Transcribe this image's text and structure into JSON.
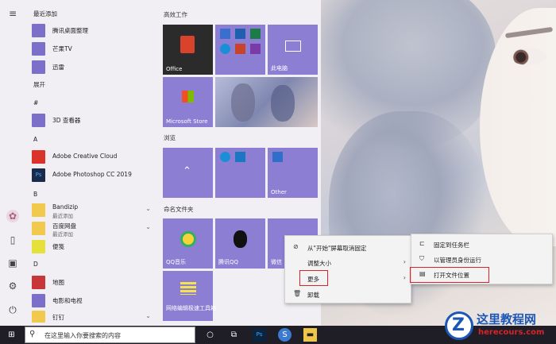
{
  "start_menu": {
    "recent_header": "最近添加",
    "expand_label": "展开",
    "recent_apps": [
      {
        "label": "腾讯桌面整理"
      },
      {
        "label": "芒果TV"
      },
      {
        "label": "迅雷"
      }
    ],
    "sections": {
      "hash": "#",
      "a": "A",
      "b": "B",
      "d": "D"
    },
    "apps": {
      "viewer3d": "3D 查看器",
      "acc": "Adobe Creative Cloud",
      "ps": "Adobe Photoshop CC 2019",
      "bandizip": "Bandizip",
      "recent_tag": "最近添加",
      "baidu": "百度网盘",
      "sticky": "便笺",
      "maps": "地图",
      "movies": "电影和电视",
      "dingding": "钉钉"
    }
  },
  "tiles": {
    "group1": "高效工作",
    "group2": "浏览",
    "group3": "命名文件夹",
    "office": "Office",
    "pc": "此电脑",
    "store": "Microsoft Store",
    "other": "Other",
    "qqmusic": "QQ音乐",
    "tencentqq": "腾讯QQ",
    "wechat": "微信",
    "netease": "网络编辑极速工具箱"
  },
  "context_menu": {
    "items": [
      {
        "icon": "unpin-icon",
        "label": "从\"开始\"屏幕取消固定"
      },
      {
        "icon": "",
        "label": "调整大小"
      },
      {
        "icon": "",
        "label": "更多"
      },
      {
        "icon": "trash-icon",
        "label": "卸载"
      }
    ]
  },
  "sub_menu": {
    "items": [
      {
        "icon": "pin-taskbar-icon",
        "label": "固定到任务栏"
      },
      {
        "icon": "admin-icon",
        "label": "以管理员身份运行"
      },
      {
        "icon": "folder-open-icon",
        "label": "打开文件位置"
      }
    ]
  },
  "taskbar": {
    "search_placeholder": "在这里输入你要搜索的内容"
  },
  "watermark": {
    "title": "这里教程网",
    "url": "herecours.com"
  },
  "colors": {
    "tile": "#8c7ed3",
    "highlight": "#d8232a",
    "taskbar": "#1f1d25"
  }
}
